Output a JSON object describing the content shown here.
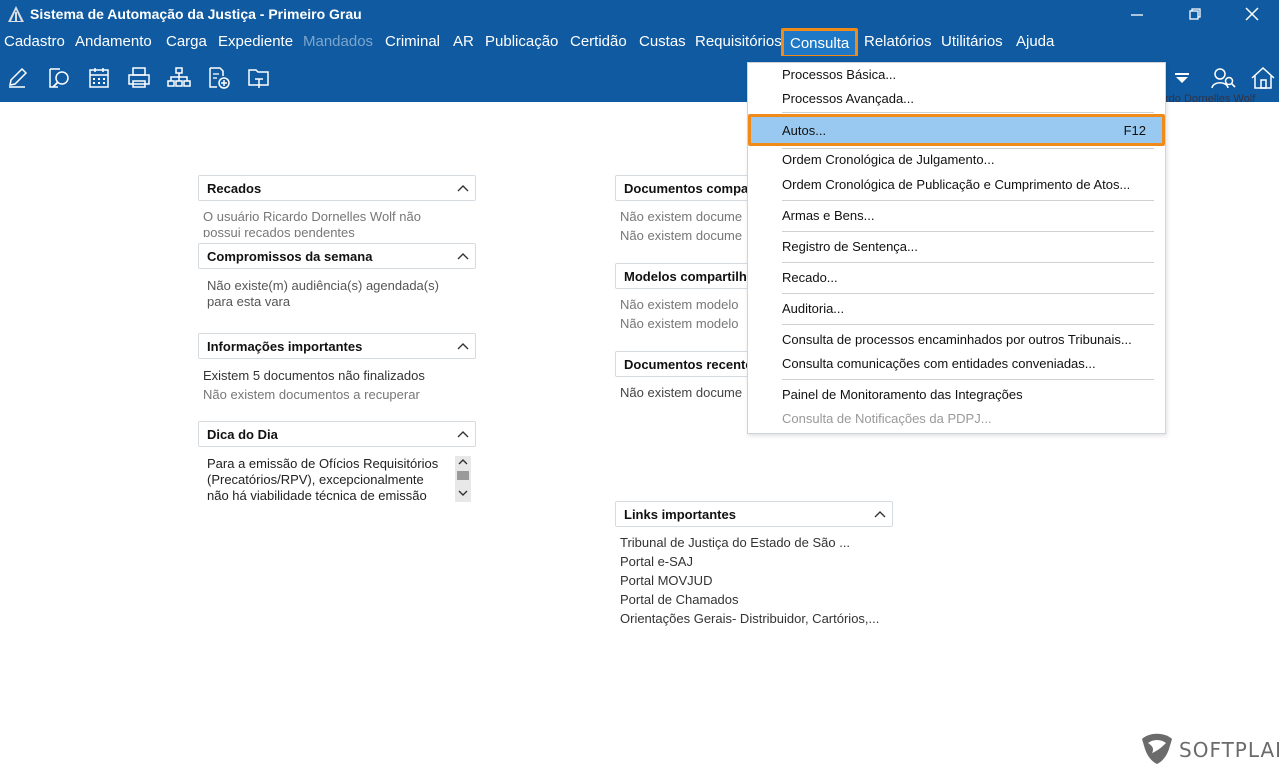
{
  "window": {
    "title": "Sistema de Automação da Justiça - Primeiro Grau"
  },
  "menubar": {
    "items": [
      {
        "label": "Cadastro"
      },
      {
        "label": "Andamento"
      },
      {
        "label": "Carga"
      },
      {
        "label": "Expediente"
      },
      {
        "label": "Mandados",
        "disabled": true
      },
      {
        "label": "Criminal"
      },
      {
        "label": "AR"
      },
      {
        "label": "Publicação"
      },
      {
        "label": "Certidão"
      },
      {
        "label": "Custas"
      },
      {
        "label": "Requisitórios"
      },
      {
        "label": "Consulta",
        "active": true
      },
      {
        "label": "Relatórios"
      },
      {
        "label": "Utilitários"
      },
      {
        "label": "Ajuda"
      }
    ]
  },
  "toolbar": {
    "icons": [
      "edit-icon",
      "search-document-icon",
      "calendar-icon",
      "printer-icon",
      "hierarchy-icon",
      "add-document-icon",
      "folder-icon",
      "dropdown-arrow-icon",
      "users-icon",
      "home-icon"
    ],
    "user_fragment": "rdo Dornelles Wolf"
  },
  "consulta_menu": {
    "items": [
      {
        "label": "Processos Básica..."
      },
      {
        "label": "Processos Avançada..."
      },
      {
        "label": "Autos...",
        "shortcut": "F12",
        "highlighted": true
      },
      {
        "label": "Ordem Cronológica de Julgamento..."
      },
      {
        "label": "Ordem Cronológica de Publicação e Cumprimento de Atos..."
      },
      {
        "label": "Armas e Bens..."
      },
      {
        "label": "Registro de Sentença..."
      },
      {
        "label": "Recado..."
      },
      {
        "label": "Auditoria..."
      },
      {
        "label": "Consulta de processos encaminhados por outros Tribunais..."
      },
      {
        "label": "Consulta comunicações com entidades conveniadas..."
      },
      {
        "label": "Painel de Monitoramento das Integrações"
      },
      {
        "label": "Consulta de Notificações da PDPJ...",
        "disabled": true
      }
    ]
  },
  "panels": {
    "recados": {
      "title": "Recados",
      "lines": [
        "O usuário Ricardo Dornelles Wolf não",
        "possui recados pendentes"
      ]
    },
    "compromissos": {
      "title": "Compromissos da semana",
      "lines": [
        "Não existe(m) audiência(s) agendada(s)",
        "para esta vara"
      ]
    },
    "informacoes": {
      "title": "Informações importantes",
      "lines": [
        "Existem 5 documentos não finalizados",
        "Não existem documentos a recuperar"
      ]
    },
    "dica": {
      "title": "Dica do Dia",
      "lines": [
        "Para a emissão de Ofícios Requisitórios",
        "(Precatórios/RPV), excepcionalmente",
        "não há viabilidade técnica de emissão"
      ]
    },
    "docs_compartilhados": {
      "title": "Documentos compa",
      "lines": [
        "Não existem docume",
        "Não existem docume"
      ]
    },
    "modelos": {
      "title": "Modelos compartilh",
      "lines": [
        "Não existem modelo",
        "Não existem modelo"
      ]
    },
    "docs_recentes": {
      "title": "Documentos recente",
      "lines": [
        "Não existem docume"
      ]
    },
    "links": {
      "title": "Links importantes",
      "lines": [
        "Tribunal de Justiça do Estado de São ...",
        "Portal e-SAJ",
        "Portal MOVJUD",
        "Portal de Chamados",
        "Orientações Gerais- Distribuidor, Cartórios,..."
      ]
    }
  },
  "brand": {
    "name": "SOFTPLAN"
  }
}
